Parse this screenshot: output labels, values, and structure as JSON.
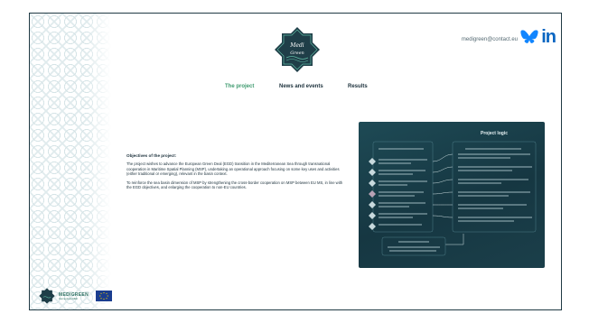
{
  "header": {
    "logo_line1": "Medi",
    "logo_line2": "Green",
    "contact_email": "medigreen@contact.eu",
    "social_bluesky": "bluesky-icon",
    "social_linkedin": "in"
  },
  "nav": {
    "items": [
      {
        "label": "The project",
        "active": true
      },
      {
        "label": "News and events",
        "active": false
      },
      {
        "label": "Results",
        "active": false
      }
    ]
  },
  "content": {
    "heading": "Objectives of the project:",
    "paragraphs": [
      "The project wishes to advance the European Green Deal (EGD) transition in the Mediterranean Sea through transnational cooperation in Maritime Spatial Planning (MSP), undertaking an operational approach focusing on some key uses and activities (either traditional or emerging), relevant in the basin context.",
      "To reinforce the sea basin dimension of MSP by strengthening the cross-border cooperation on MSP between EU MS, in line with the EGD objectives, and enlarging the cooperation to non-EU countries."
    ]
  },
  "infographic": {
    "title": "Project logic"
  },
  "footer": {
    "brand": "MEDIGREEN",
    "brand_sub": "Interreg Euro-MED"
  },
  "colors": {
    "accent": "#3d9a6e",
    "dark": "#1a2f3a",
    "infographic_bg": "#163742",
    "linkedin": "#0a66c2",
    "bluesky": "#1185fe"
  }
}
